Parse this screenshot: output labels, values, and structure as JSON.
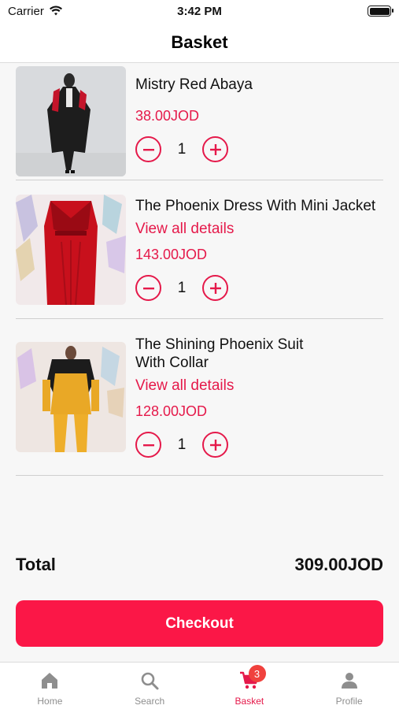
{
  "status_bar": {
    "carrier": "Carrier",
    "time": "3:42 PM"
  },
  "header": {
    "title": "Basket"
  },
  "items": [
    {
      "name": "Mistry Red Abaya",
      "price": "38.00JOD",
      "quantity": "1"
    },
    {
      "name": "The Phoenix Dress With Mini Jacket",
      "details_link": "View all details",
      "price": "143.00JOD",
      "quantity": "1"
    },
    {
      "name": "The Shining Phoenix Suit With Collar",
      "details_link": "View all details",
      "price": "128.00JOD",
      "quantity": "1"
    }
  ],
  "total": {
    "label": "Total",
    "value": "309.00JOD"
  },
  "checkout": {
    "label": "Checkout"
  },
  "tabs": [
    {
      "label": "Home",
      "icon": "home-icon"
    },
    {
      "label": "Search",
      "icon": "search-icon"
    },
    {
      "label": "Basket",
      "icon": "cart-icon",
      "badge": "3",
      "active": true
    },
    {
      "label": "Profile",
      "icon": "person-icon"
    }
  ],
  "colors": {
    "accent": "#e5194a",
    "checkout": "#fb1747",
    "inactive_tab": "#8e8e8e"
  }
}
